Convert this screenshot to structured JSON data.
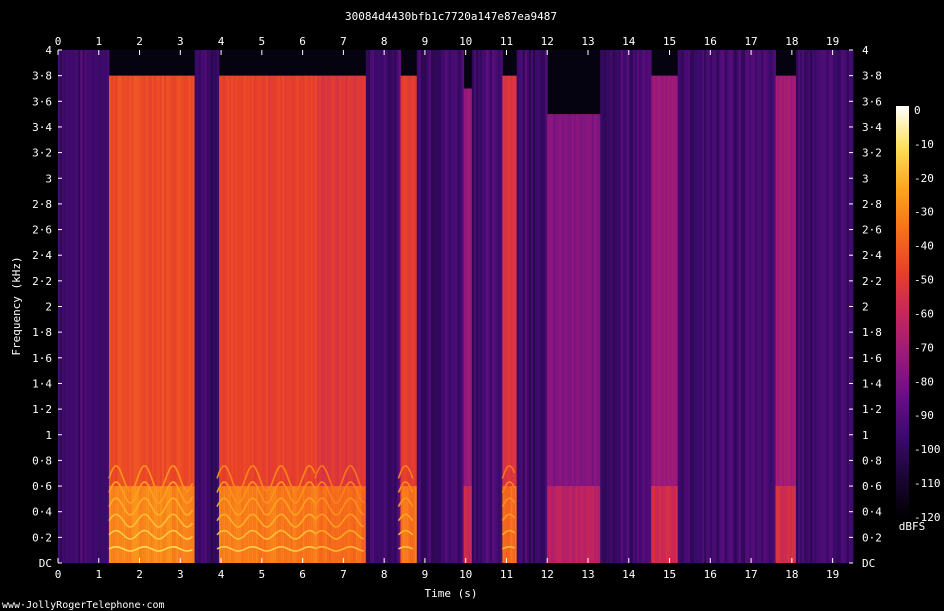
{
  "chart_data": {
    "type": "heatmap",
    "title": "30084d4430bfb1c7720a147e87ea9487",
    "xlabel": "Time (s)",
    "ylabel": "Frequency (kHz)",
    "xlim": [
      0,
      19.5
    ],
    "ylim": [
      0,
      4
    ],
    "x_ticks": [
      "0",
      "1",
      "2",
      "3",
      "4",
      "5",
      "6",
      "7",
      "8",
      "9",
      "10",
      "11",
      "12",
      "13",
      "14",
      "15",
      "16",
      "17",
      "18",
      "19"
    ],
    "y_ticks": [
      "DC",
      "0·2",
      "0·4",
      "0·6",
      "0·8",
      "1",
      "1·2",
      "1·4",
      "1·6",
      "1·8",
      "2",
      "2·2",
      "2·4",
      "2·6",
      "2·8",
      "3",
      "3·2",
      "3·4",
      "3·6",
      "3·8",
      "4"
    ],
    "colorbar": {
      "label": "dBFS",
      "ticks": [
        "0",
        "-10",
        "-20",
        "-30",
        "-40",
        "-50",
        "-60",
        "-70",
        "-80",
        "-90",
        "-100",
        "-110",
        "-120"
      ],
      "range": [
        -120,
        0
      ],
      "colors": [
        "#000000",
        "#1a0533",
        "#3b0a6b",
        "#6a0f84",
        "#9a1a7a",
        "#c8265a",
        "#e8402a",
        "#f7701a",
        "#fca51d",
        "#fde05a",
        "#ffffff"
      ]
    },
    "segments": [
      {
        "t0": 1.25,
        "t1": 3.3,
        "level": -45,
        "fmax": 3.8
      },
      {
        "t0": 3.9,
        "t1": 6.3,
        "level": -48,
        "fmax": 3.8
      },
      {
        "t0": 6.3,
        "t1": 7.5,
        "level": -52,
        "fmax": 3.8
      },
      {
        "t0": 8.35,
        "t1": 8.75,
        "level": -50,
        "fmax": 3.8
      },
      {
        "t0": 9.95,
        "t1": 10.15,
        "level": -72,
        "fmax": 3.7
      },
      {
        "t0": 10.9,
        "t1": 11.25,
        "level": -52,
        "fmax": 3.8
      },
      {
        "t0": 12.0,
        "t1": 13.3,
        "level": -78,
        "fmax": 3.5
      },
      {
        "t0": 14.55,
        "t1": 15.2,
        "level": -72,
        "fmax": 3.8
      },
      {
        "t0": 17.6,
        "t1": 18.1,
        "level": -70,
        "fmax": 3.8
      }
    ],
    "background_level": -100,
    "pitch_hz": 110
  },
  "footer": {
    "credit": "www·JollyRogerTelephone·com"
  }
}
